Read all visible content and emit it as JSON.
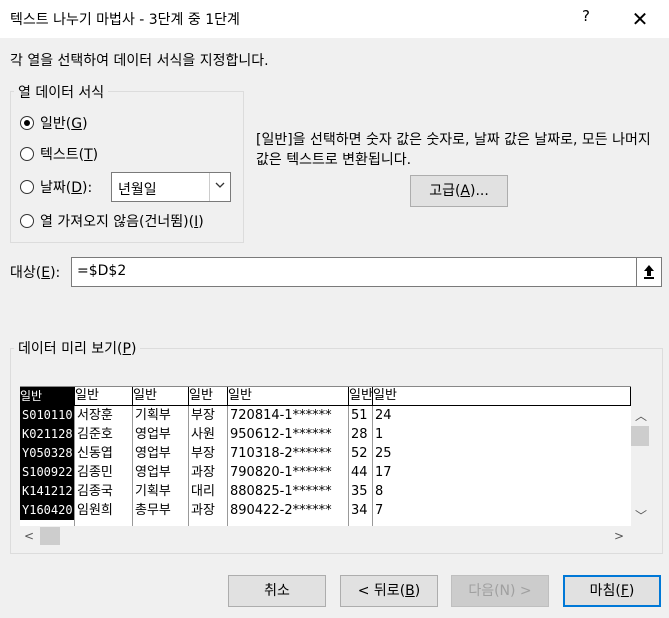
{
  "window": {
    "title": "텍스트 나누기 마법사 - 3단계 중 1단계",
    "help": "?",
    "close": "✕"
  },
  "description": "각 열을 선택하여 데이터 서식을 지정합니다.",
  "format_group": {
    "label": "열 데이터 서식",
    "options": [
      {
        "label": "일반(",
        "key": "G",
        "tail": ")",
        "checked": true
      },
      {
        "label": "텍스트(",
        "key": "T",
        "tail": ")",
        "checked": false
      },
      {
        "label": "날짜(",
        "key": "D",
        "tail": "):",
        "checked": false
      },
      {
        "label": "열 가져오지 않음(건너뜀)(",
        "key": "I",
        "tail": ")",
        "checked": false
      }
    ],
    "date_format": "년월일"
  },
  "info_text": "[일반]을 선택하면 숫자 값은 숫자로, 날짜 값은 날짜로, 모든 나머지 값은 텍스트로 변환됩니다.",
  "advanced": {
    "label": "고급(",
    "key": "A",
    "tail": ")..."
  },
  "target": {
    "label": "대상(",
    "key": "E",
    "tail": "):",
    "value": "=$D$2"
  },
  "preview": {
    "label": "데이터 미리 보기(",
    "key": "P",
    "tail": ")",
    "headers": [
      "일반",
      "일반",
      "일반",
      "일반",
      "일반",
      "일반",
      "일반"
    ],
    "rows": [
      [
        "S010110",
        "서장훈",
        "기획부",
        "부장",
        "720814-1******",
        "51",
        "24"
      ],
      [
        "K021128",
        "김준호",
        "영업부",
        "사원",
        "950612-1******",
        "28",
        "1"
      ],
      [
        "Y050328",
        "신동엽",
        "영업부",
        "부장",
        "710318-2******",
        "52",
        "25"
      ],
      [
        "S100922",
        "김종민",
        "영업부",
        "과장",
        "790820-1******",
        "44",
        "17"
      ],
      [
        "K141212",
        "김종국",
        "기획부",
        "대리",
        "880825-1******",
        "35",
        "8"
      ],
      [
        "Y160420",
        "임원희",
        "총무부",
        "과장",
        "890422-2******",
        "34",
        "7"
      ]
    ]
  },
  "buttons": {
    "cancel": "취소",
    "back": {
      "label": "< 뒤로(",
      "key": "B",
      "tail": ")"
    },
    "next": {
      "label": "다음(N) >"
    },
    "finish": {
      "label": "마침(",
      "key": "F",
      "tail": ")"
    }
  },
  "colors": {
    "accent": "#0078d7",
    "selection": "#000000"
  }
}
